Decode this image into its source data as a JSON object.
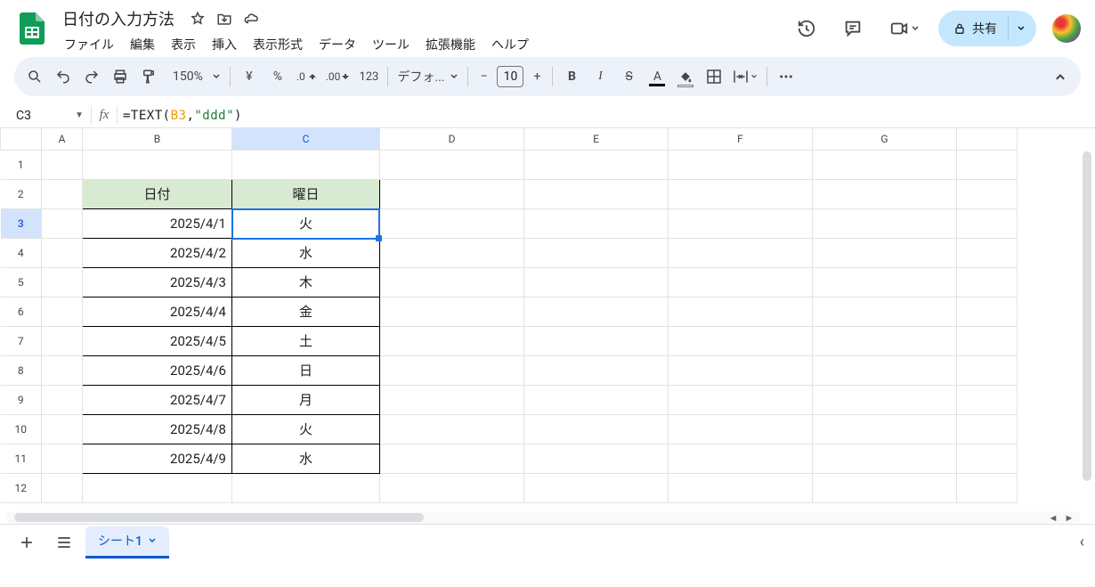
{
  "doc": {
    "title": "日付の入力方法"
  },
  "menus": [
    "ファイル",
    "編集",
    "表示",
    "挿入",
    "表示形式",
    "データ",
    "ツール",
    "拡張機能",
    "ヘルプ"
  ],
  "toolbar": {
    "zoom": "150%",
    "currency": "¥",
    "percent": "%",
    "dec_dec": ".0",
    "inc_dec": ".00",
    "num_fmt": "123",
    "font": "デフォ...",
    "font_size": "10"
  },
  "share": {
    "label": "共有"
  },
  "name_box": "C3",
  "formula": {
    "func_open": "=TEXT(",
    "ref": "B3",
    "mid": ",",
    "str": "\"ddd\"",
    "close": ")"
  },
  "columns": [
    "A",
    "B",
    "C",
    "D",
    "E",
    "F",
    "G",
    ""
  ],
  "rows_visible": 12,
  "selected": {
    "col_index": 2,
    "row_index": 2
  },
  "table": {
    "header": {
      "date": "日付",
      "day": "曜日"
    },
    "rows": [
      {
        "date": "2025/4/1",
        "day": "火"
      },
      {
        "date": "2025/4/2",
        "day": "水"
      },
      {
        "date": "2025/4/3",
        "day": "木"
      },
      {
        "date": "2025/4/4",
        "day": "金"
      },
      {
        "date": "2025/4/5",
        "day": "土"
      },
      {
        "date": "2025/4/6",
        "day": "日"
      },
      {
        "date": "2025/4/7",
        "day": "月"
      },
      {
        "date": "2025/4/8",
        "day": "火"
      },
      {
        "date": "2025/4/9",
        "day": "水"
      }
    ]
  },
  "sheet_tab": "シート1"
}
